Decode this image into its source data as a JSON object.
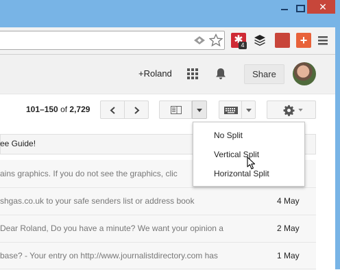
{
  "header": {
    "user_link": "+Roland",
    "share_label": "Share"
  },
  "toolbar": {
    "page_range": "101–150",
    "page_of": "of",
    "page_total": "2,729"
  },
  "menu": {
    "items": [
      {
        "label": "No Split"
      },
      {
        "label": "Vertical Split"
      },
      {
        "label": "Horizontal Split"
      }
    ]
  },
  "extensions": {
    "lastpass_badge": "4"
  },
  "banner": {
    "text": "ee Guide!"
  },
  "emails": [
    {
      "snippet": "ains graphics. If you do not see the graphics, clic",
      "date": ""
    },
    {
      "snippet": "shgas.co.uk to your safe senders list or address book",
      "date": "4 May"
    },
    {
      "snippet": "Dear Roland, Do you have a minute? We want your opinion a",
      "date": "2 May"
    },
    {
      "snippet": "base? - Your entry on http://www.journalistdirectory.com has",
      "date": "1 May"
    }
  ],
  "colors": {
    "titlebar": "#78b4e6",
    "close": "#c7463a",
    "lastpass": "#cf2a35"
  }
}
